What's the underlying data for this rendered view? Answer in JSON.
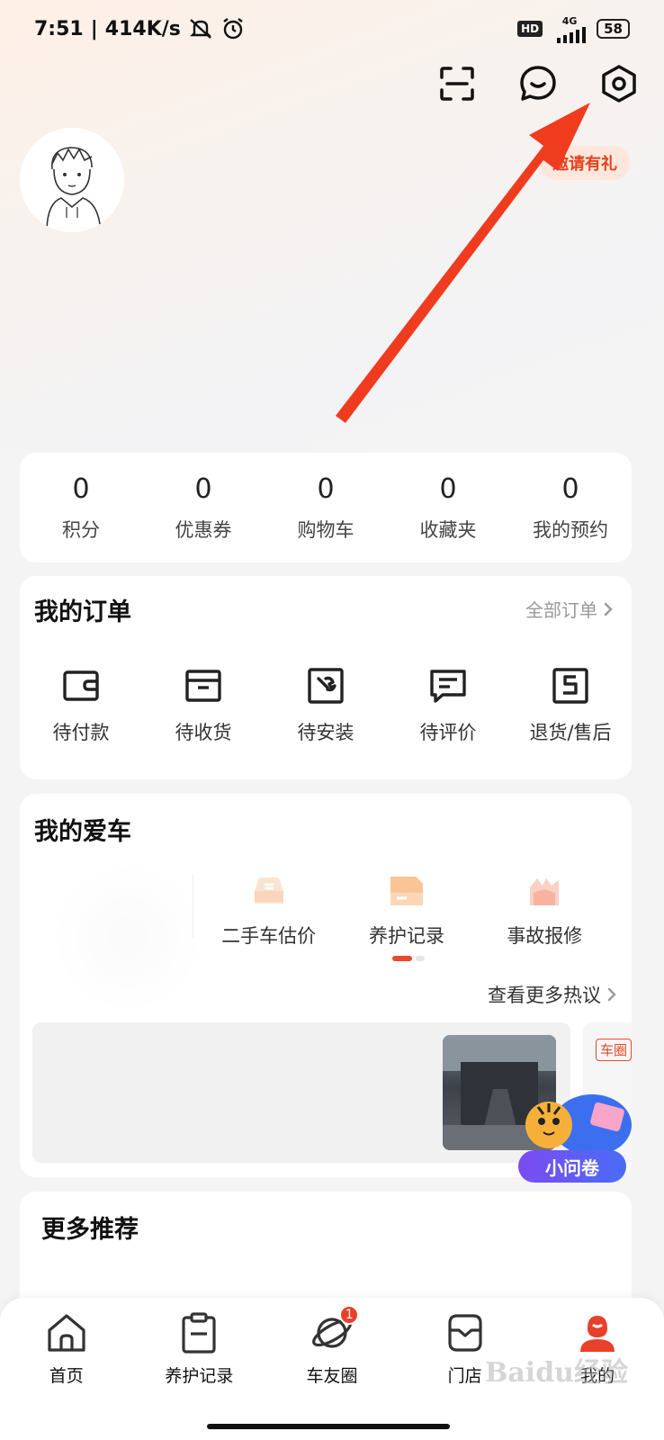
{
  "status_bar": {
    "time": "7:51",
    "net_speed": "414K/s",
    "hd": "HD",
    "network": "4G",
    "battery": "58"
  },
  "header": {
    "promo": "邀请有礼"
  },
  "stats": [
    {
      "value": "0",
      "label": "积分"
    },
    {
      "value": "0",
      "label": "优惠券"
    },
    {
      "value": "0",
      "label": "购物车"
    },
    {
      "value": "0",
      "label": "收藏夹"
    },
    {
      "value": "0",
      "label": "我的预约"
    }
  ],
  "orders": {
    "title": "我的订单",
    "all_label": "全部订单",
    "items": [
      {
        "label": "待付款",
        "icon": "wallet-icon"
      },
      {
        "label": "待收货",
        "icon": "box-icon"
      },
      {
        "label": "待安装",
        "icon": "wrench-icon"
      },
      {
        "label": "待评价",
        "icon": "comment-icon"
      },
      {
        "label": "退货/售后",
        "icon": "return-icon"
      }
    ]
  },
  "my_car": {
    "title": "我的爱车",
    "tools": [
      {
        "label": "二手车估价",
        "icon": "car-value-icon"
      },
      {
        "label": "养护记录",
        "icon": "maintenance-icon"
      },
      {
        "label": "事故报修",
        "icon": "accident-icon"
      }
    ],
    "more_hot": "查看更多热议",
    "feed_tag": "车圈",
    "survey_label": "小问卷"
  },
  "recommend": {
    "title": "更多推荐"
  },
  "tabbar": {
    "items": [
      {
        "label": "首页",
        "icon": "home-icon"
      },
      {
        "label": "养护记录",
        "icon": "clipboard-icon"
      },
      {
        "label": "车友圈",
        "icon": "planet-icon",
        "badge": "1"
      },
      {
        "label": "门店",
        "icon": "store-icon"
      },
      {
        "label": "我的",
        "icon": "profile-icon",
        "active": true
      }
    ]
  },
  "watermark": "Baidu经验",
  "colors": {
    "accent": "#e84a2c",
    "arrow": "#f03c1e",
    "text_primary": "#222222",
    "text_secondary": "#999999"
  }
}
